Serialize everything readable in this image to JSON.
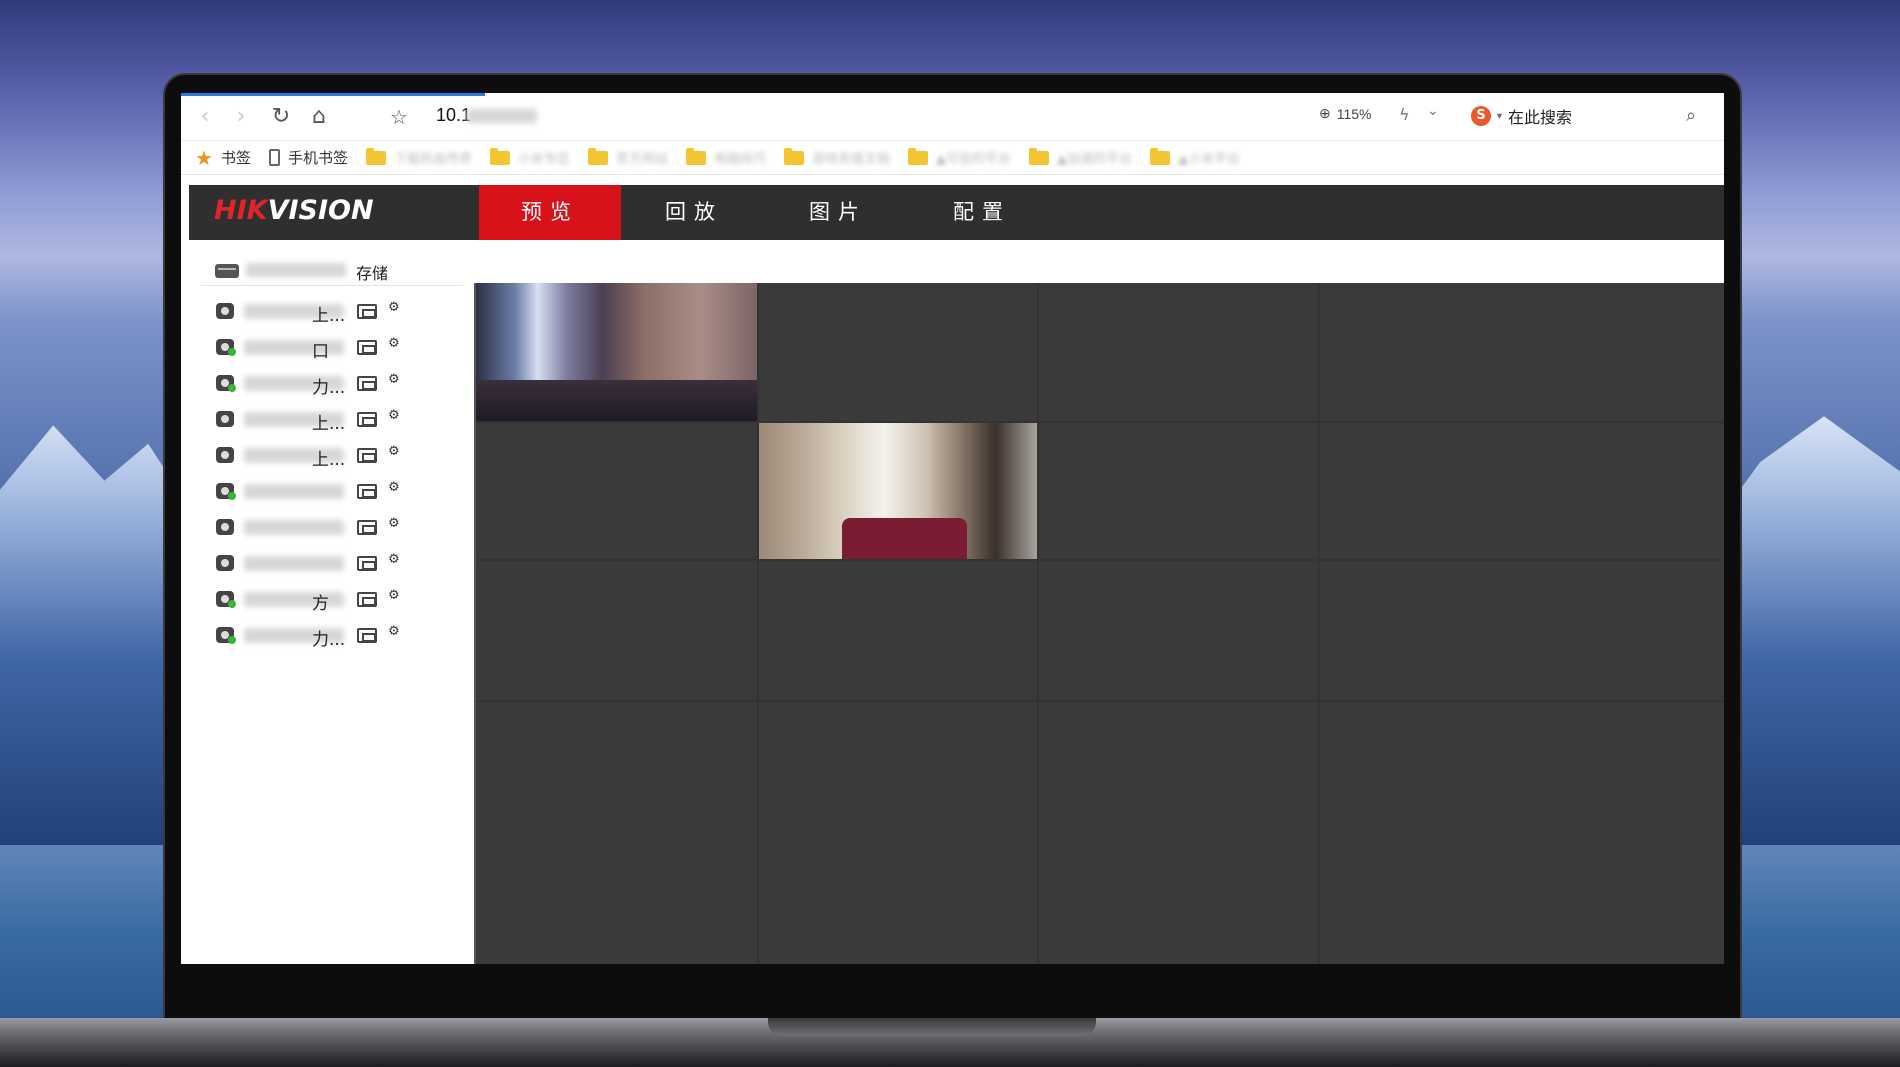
{
  "browser": {
    "address_prefix": "10.1",
    "zoom": "115%",
    "search_placeholder": "在此搜索",
    "bookmarks": {
      "bookmarks_label": "书签",
      "mobile_label": "手机书签",
      "folders": [
        "下载热血传奇",
        "小米专区",
        "官方网站",
        "电脑技巧",
        "游戏充值文档",
        "▲可信的平台",
        "▲加速的平台",
        "▲小米平台"
      ]
    }
  },
  "app": {
    "brand": {
      "hik": "HIK",
      "vision": "VISION"
    },
    "tabs": [
      "预览",
      "回放",
      "图片",
      "配置"
    ],
    "active_tab": "预览",
    "storage_label": "存储",
    "channels": [
      {
        "label": "上...",
        "online": false
      },
      {
        "label": "口",
        "online": true
      },
      {
        "label": "力...",
        "online": true
      },
      {
        "label": "上...",
        "online": false
      },
      {
        "label": "上...",
        "online": false
      },
      {
        "label": "",
        "online": true
      },
      {
        "label": "",
        "online": false
      },
      {
        "label": "",
        "online": false
      },
      {
        "label": "方",
        "online": true
      },
      {
        "label": "力...",
        "online": true
      }
    ],
    "preview_grid": {
      "rows": 4,
      "cols": 4,
      "active_feeds": [
        0,
        5
      ]
    }
  }
}
